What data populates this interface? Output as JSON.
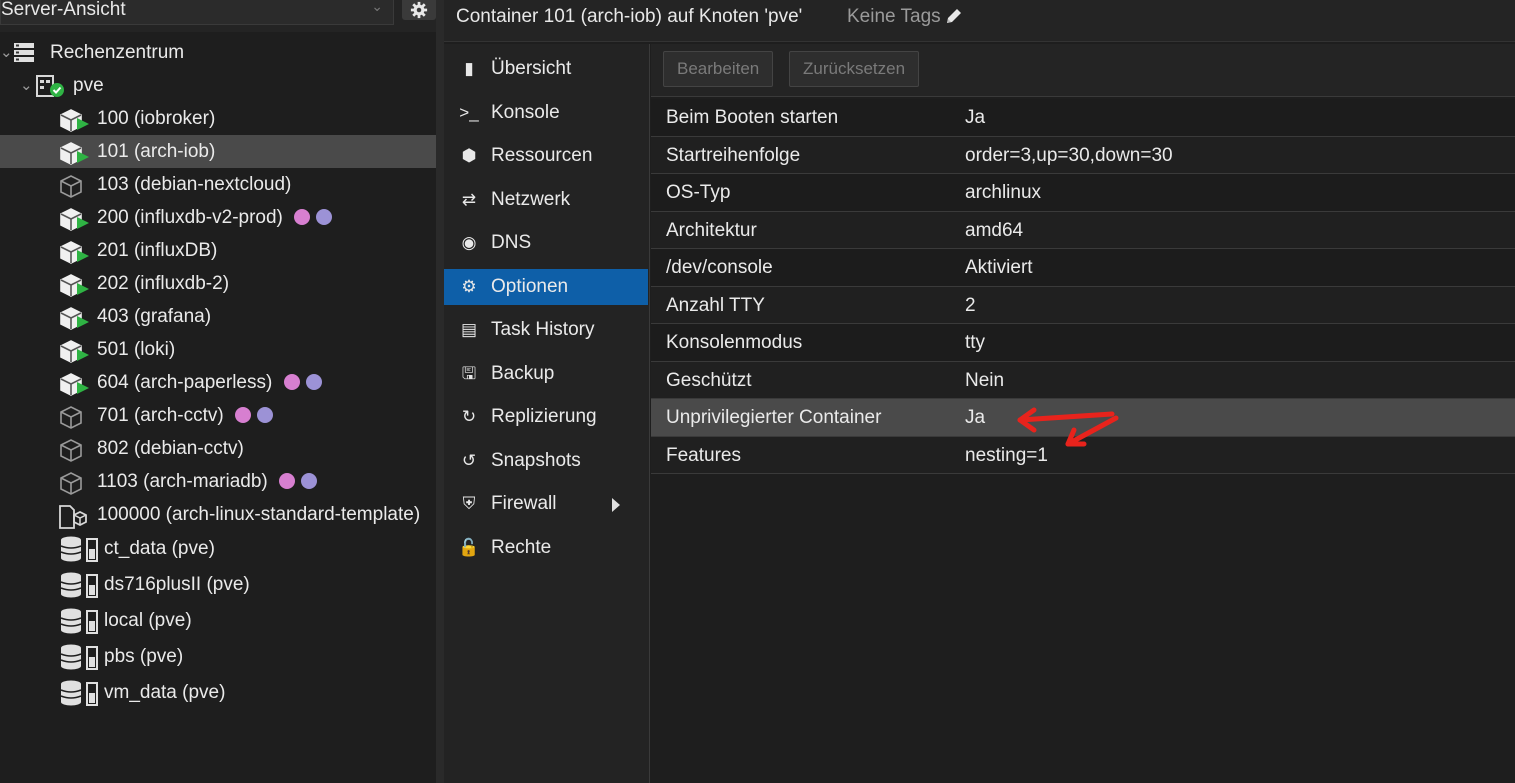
{
  "left": {
    "view_select": {
      "value": "Server-Ansicht"
    },
    "datacenter": "Rechenzentrum",
    "node": "pve",
    "guests": [
      {
        "label": "100 (iobroker)",
        "status": "running",
        "tags": []
      },
      {
        "label": "101 (arch-iob)",
        "status": "running",
        "tags": [],
        "selected": true
      },
      {
        "label": "103 (debian-nextcloud)",
        "status": "stopped",
        "tags": []
      },
      {
        "label": "200 (influxdb-v2-prod)",
        "status": "running",
        "tags": [
          "#d77fd0",
          "#9c92d6"
        ]
      },
      {
        "label": "201 (influxDB)",
        "status": "running",
        "tags": []
      },
      {
        "label": "202 (influxdb-2)",
        "status": "running",
        "tags": []
      },
      {
        "label": "403 (grafana)",
        "status": "running",
        "tags": []
      },
      {
        "label": "501 (loki)",
        "status": "running",
        "tags": []
      },
      {
        "label": "604 (arch-paperless)",
        "status": "running",
        "tags": [
          "#d77fd0",
          "#9c92d6"
        ]
      },
      {
        "label": "701 (arch-cctv)",
        "status": "stopped",
        "tags": [
          "#d77fd0",
          "#9c92d6"
        ]
      },
      {
        "label": "802 (debian-cctv)",
        "status": "stopped",
        "tags": []
      },
      {
        "label": "1103 (arch-mariadb)",
        "status": "stopped",
        "tags": [
          "#d77fd0",
          "#9c92d6"
        ]
      },
      {
        "label": "100000 (arch-linux-standard-template)",
        "status": "template",
        "tags": []
      }
    ],
    "storages": [
      {
        "label": "ct_data (pve)"
      },
      {
        "label": "ds716plusII (pve)"
      },
      {
        "label": "local (pve)"
      },
      {
        "label": "pbs (pve)"
      },
      {
        "label": "vm_data (pve)"
      }
    ]
  },
  "header": {
    "title": "Container 101 (arch-iob) auf Knoten 'pve'",
    "tags_label": "Keine Tags"
  },
  "nav": [
    {
      "label": "Übersicht",
      "icon": "book-icon"
    },
    {
      "label": "Konsole",
      "icon": "terminal-icon"
    },
    {
      "label": "Ressourcen",
      "icon": "cube-icon"
    },
    {
      "label": "Netzwerk",
      "icon": "exchange-icon"
    },
    {
      "label": "DNS",
      "icon": "globe-icon"
    },
    {
      "label": "Optionen",
      "icon": "gear-icon",
      "active": true
    },
    {
      "label": "Task History",
      "icon": "list-icon"
    },
    {
      "label": "Backup",
      "icon": "floppy-icon"
    },
    {
      "label": "Replizierung",
      "icon": "retweet-icon"
    },
    {
      "label": "Snapshots",
      "icon": "history-icon"
    },
    {
      "label": "Firewall",
      "icon": "shield-icon",
      "has_submenu": true
    },
    {
      "label": "Rechte",
      "icon": "unlock-icon"
    }
  ],
  "toolbar": {
    "edit_label": "Bearbeiten",
    "revert_label": "Zurücksetzen"
  },
  "options": [
    {
      "key": "Beim Booten starten",
      "value": "Ja"
    },
    {
      "key": "Startreihenfolge",
      "value": "order=3,up=30,down=30"
    },
    {
      "key": "OS-Typ",
      "value": "archlinux"
    },
    {
      "key": "Architektur",
      "value": "amd64"
    },
    {
      "key": "/dev/console",
      "value": "Aktiviert"
    },
    {
      "key": "Anzahl TTY",
      "value": "2"
    },
    {
      "key": "Konsolenmodus",
      "value": "tty"
    },
    {
      "key": "Geschützt",
      "value": "Nein"
    },
    {
      "key": "Unprivilegierter Container",
      "value": "Ja",
      "selected": true
    },
    {
      "key": "Features",
      "value": "nesting=1"
    }
  ],
  "colors": {
    "accent": "#0e5fa8",
    "running": "#2fb344",
    "annotation": "#e8231c"
  }
}
